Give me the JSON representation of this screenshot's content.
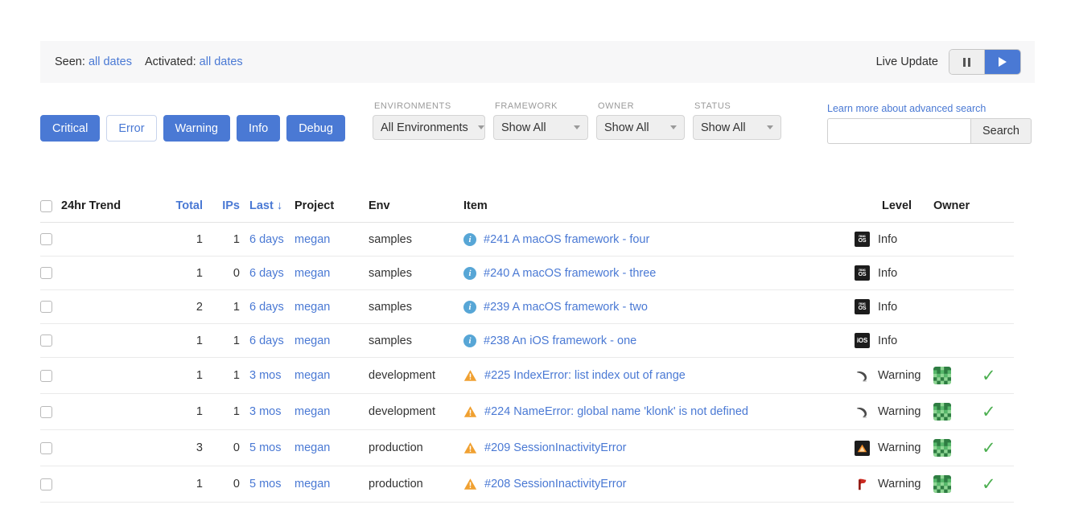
{
  "datebar": {
    "seen_label": "Seen:",
    "seen_value": "all dates",
    "activated_label": "Activated:",
    "activated_value": "all dates",
    "live_update_label": "Live Update",
    "pause_icon": "pause-icon",
    "play_icon": "play-icon"
  },
  "levels": [
    {
      "label": "Critical",
      "selected": true
    },
    {
      "label": "Error",
      "selected": false
    },
    {
      "label": "Warning",
      "selected": true
    },
    {
      "label": "Info",
      "selected": true
    },
    {
      "label": "Debug",
      "selected": true
    }
  ],
  "filters": [
    {
      "label": "ENVIRONMENTS",
      "value": "All Environments"
    },
    {
      "label": "FRAMEWORK",
      "value": "Show All"
    },
    {
      "label": "OWNER",
      "value": "Show All"
    },
    {
      "label": "STATUS",
      "value": "Show All"
    }
  ],
  "search": {
    "learn_more": "Learn more about advanced search",
    "value": "",
    "placeholder": "",
    "button_label": "Search"
  },
  "table": {
    "headers": {
      "trend": "24hr Trend",
      "total": "Total",
      "ips": "IPs",
      "last": "Last",
      "last_sort_icon": "sort-desc-arrow-icon",
      "project": "Project",
      "env": "Env",
      "item": "Item",
      "level": "Level",
      "owner": "Owner"
    },
    "rows": [
      {
        "total": "1",
        "ips": "1",
        "last": "6 days",
        "project": "megan",
        "env": "samples",
        "item": "#241 A macOS framework - four",
        "item_icon": "info-icon",
        "level": "Info",
        "platform": "macos",
        "owner_avatar": false,
        "resolved": false
      },
      {
        "total": "1",
        "ips": "0",
        "last": "6 days",
        "project": "megan",
        "env": "samples",
        "item": "#240 A macOS framework - three",
        "item_icon": "info-icon",
        "level": "Info",
        "platform": "macos",
        "owner_avatar": false,
        "resolved": false
      },
      {
        "total": "2",
        "ips": "1",
        "last": "6 days",
        "project": "megan",
        "env": "samples",
        "item": "#239 A macOS framework - two",
        "item_icon": "info-icon",
        "level": "Info",
        "platform": "macos",
        "owner_avatar": false,
        "resolved": false
      },
      {
        "total": "1",
        "ips": "1",
        "last": "6 days",
        "project": "megan",
        "env": "samples",
        "item": "#238 An iOS framework - one",
        "item_icon": "info-icon",
        "level": "Info",
        "platform": "ios",
        "owner_avatar": false,
        "resolved": false
      },
      {
        "total": "1",
        "ips": "1",
        "last": "3 mos",
        "project": "megan",
        "env": "development",
        "item": "#225 IndexError: list index out of range",
        "item_icon": "warning-icon",
        "level": "Warning",
        "platform": "python",
        "owner_avatar": true,
        "resolved": true
      },
      {
        "total": "1",
        "ips": "1",
        "last": "3 mos",
        "project": "megan",
        "env": "development",
        "item": "#224 NameError: global name 'klonk' is not defined",
        "item_icon": "warning-icon",
        "level": "Warning",
        "platform": "python",
        "owner_avatar": true,
        "resolved": true
      },
      {
        "total": "3",
        "ips": "0",
        "last": "5 mos",
        "project": "megan",
        "env": "production",
        "item": "#209 SessionInactivityError",
        "item_icon": "warning-icon",
        "level": "Warning",
        "platform": "triangle",
        "owner_avatar": true,
        "resolved": true
      },
      {
        "total": "1",
        "ips": "0",
        "last": "5 mos",
        "project": "megan",
        "env": "production",
        "item": "#208 SessionInactivityError",
        "item_icon": "warning-icon",
        "level": "Warning",
        "platform": "flag",
        "owner_avatar": true,
        "resolved": true
      }
    ]
  },
  "colors": {
    "accent_blue": "#4a79d4",
    "link_blue": "#4a79d4",
    "warning_orange": "#f0a030",
    "info_blue": "#57a6d6",
    "check_green": "#4caf50",
    "avatar_green": "#3f8f54",
    "bar_grey": "#f7f7f8"
  }
}
